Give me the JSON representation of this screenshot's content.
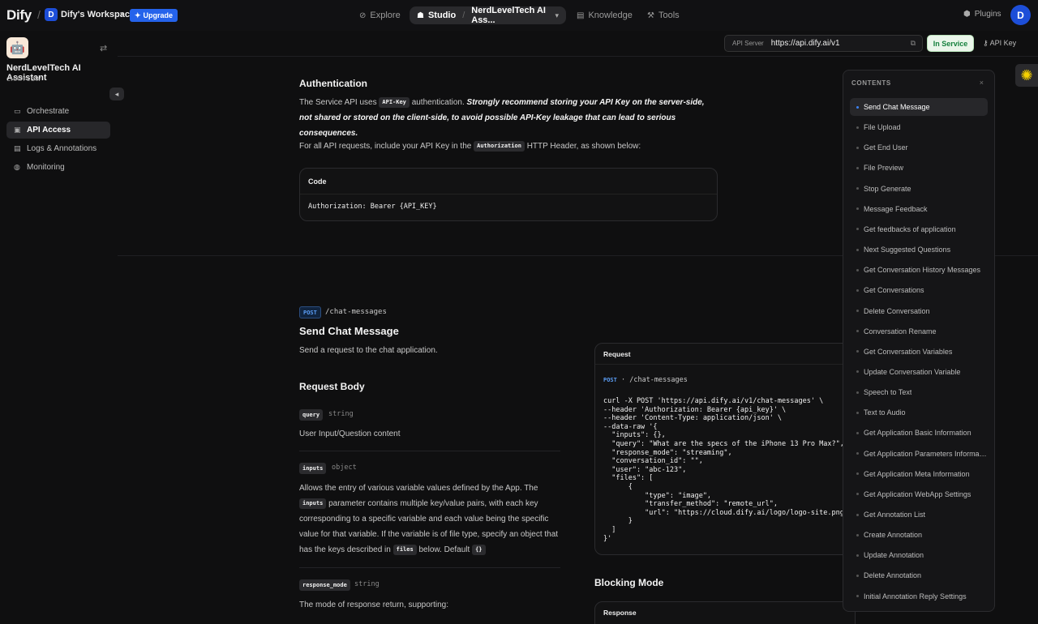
{
  "topbar": {
    "logo": "Dify",
    "workspace_initial": "D",
    "workspace_name": "Dify's Workspace",
    "upgrade_label": "Upgrade",
    "nav_explore": "Explore",
    "nav_studio": "Studio",
    "nav_app": "NerdLevelTech AI Ass...",
    "nav_knowledge": "Knowledge",
    "nav_tools": "Tools",
    "plugins": "Plugins",
    "user_initial": "D"
  },
  "sidebar": {
    "app_name": "NerdLevelTech AI Assistant",
    "app_type": "CHATFLOW",
    "items": [
      {
        "label": "Orchestrate"
      },
      {
        "label": "API Access"
      },
      {
        "label": "Logs & Annotations"
      },
      {
        "label": "Monitoring"
      }
    ]
  },
  "subheader": {
    "api_server_label": "API Server",
    "api_server_url": "https://api.dify.ai/v1",
    "status": "In Service",
    "api_key_label": "API Key"
  },
  "doc": {
    "auth_title": "Authentication",
    "auth_p1_a": "The Service API uses",
    "auth_p1_chip": "API-Key",
    "auth_p1_b": "authentication.",
    "auth_p1_strong": "Strongly recommend storing your API Key on the server-side, not shared or stored on the client-side, to avoid possible API-Key leakage that can lead to serious consequences.",
    "auth_p2_a": "For all API requests, include your API Key in the",
    "auth_p2_chip": "Authorization",
    "auth_p2_b": "HTTP Header, as shown below:",
    "code_head": "Code",
    "code_body": "Authorization: Bearer {API_KEY}",
    "method": "POST",
    "endpoint": "/chat-messages",
    "send_title": "Send Chat Message",
    "send_desc": "Send a request to the chat application.",
    "request_body": "Request Body",
    "p_query": "query",
    "p_query_type": "string",
    "p_query_desc": "User Input/Question content",
    "p_inputs": "inputs",
    "p_inputs_type": "object",
    "p_inputs_desc_a": "Allows the entry of various variable values defined by the App. The",
    "p_inputs_chip": "inputs",
    "p_inputs_desc_b": "parameter contains multiple key/value pairs, with each key corresponding to a specific variable and each value being the specific value for that variable. If the variable is of file type, specify an object that has the keys described in",
    "p_inputs_chip2": "files",
    "p_inputs_desc_c": "below. Default",
    "p_inputs_chip3": "{}",
    "p_response_mode": "response_mode",
    "p_response_mode_type": "string",
    "p_response_mode_desc": "The mode of response return, supporting:",
    "request_head": "Request",
    "request_method": "POST",
    "request_endpoint": "/chat-messages",
    "request_code": "curl -X POST 'https://api.dify.ai/v1/chat-messages' \\\n--header 'Authorization: Bearer {api_key}' \\\n--header 'Content-Type: application/json' \\\n--data-raw '{\n  \"inputs\": {},\n  \"query\": \"What are the specs of the iPhone 13 Pro Max?\",\n  \"response_mode\": \"streaming\",\n  \"conversation_id\": \"\",\n  \"user\": \"abc-123\",\n  \"files\": [\n      {\n          \"type\": \"image\",\n          \"transfer_method\": \"remote_url\",\n          \"url\": \"https://cloud.dify.ai/logo/logo-site.png\"\n      }\n  ]\n}'",
    "blocking_mode": "Blocking Mode",
    "response_head": "Response"
  },
  "contents": {
    "title": "CONTENTS",
    "items": [
      "Send Chat Message",
      "File Upload",
      "Get End User",
      "File Preview",
      "Stop Generate",
      "Message Feedback",
      "Get feedbacks of application",
      "Next Suggested Questions",
      "Get Conversation History Messages",
      "Get Conversations",
      "Delete Conversation",
      "Conversation Rename",
      "Get Conversation Variables",
      "Update Conversation Variable",
      "Speech to Text",
      "Text to Audio",
      "Get Application Basic Information",
      "Get Application Parameters Information",
      "Get Application Meta Information",
      "Get Application WebApp Settings",
      "Get Annotation List",
      "Create Annotation",
      "Update Annotation",
      "Delete Annotation",
      "Initial Annotation Reply Settings"
    ]
  },
  "colors": {
    "accent": "#2563eb",
    "status_green": "#15803d"
  }
}
